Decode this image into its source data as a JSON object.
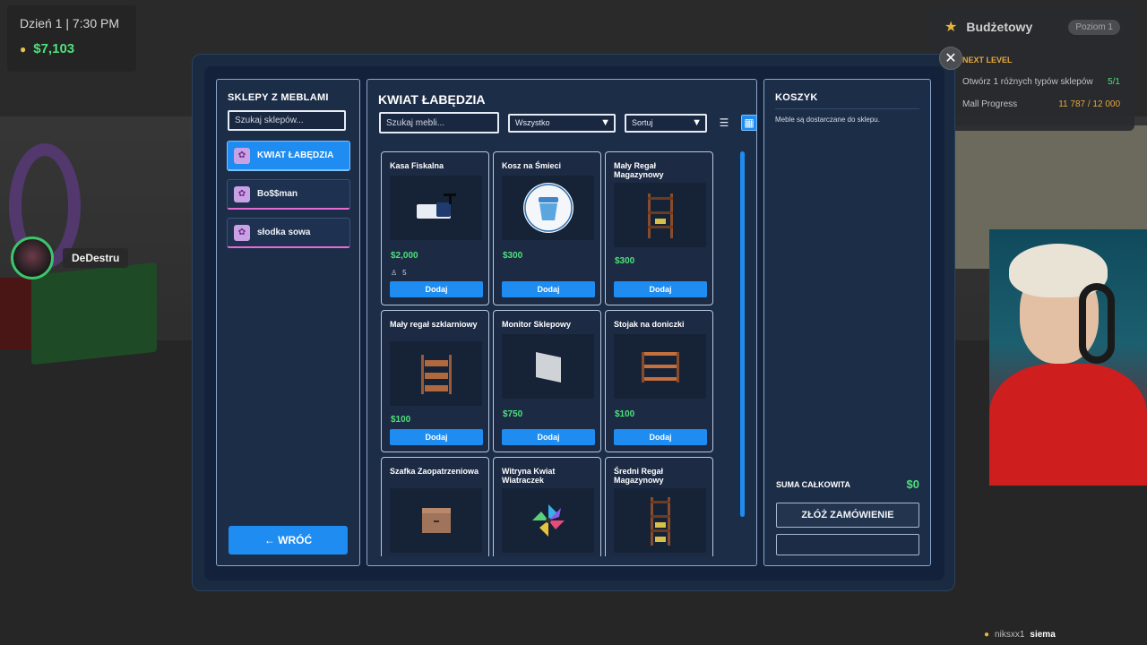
{
  "hud": {
    "day": "Dzień 1 | 7:30 PM",
    "money": "$7,103"
  },
  "player": {
    "name": "DeDestru"
  },
  "level_panel": {
    "title": "Budżetowy",
    "level": "Poziom 1",
    "next_level": "NEXT LEVEL",
    "goals": [
      {
        "label": "Otwórz 1 różnych typów sklepów",
        "value": "5/1"
      },
      {
        "label": "Mall Progress",
        "value": "11 787 / 12 000"
      }
    ]
  },
  "shops": {
    "title": "SKLEPY Z MEBLAMI",
    "search_placeholder": "Szukaj sklepów...",
    "items": [
      {
        "label": "KWIAT ŁABĘDZIA",
        "active": true
      },
      {
        "label": "Bo$$man",
        "active": false
      },
      {
        "label": "słodka sowa",
        "active": false
      }
    ],
    "back_label": "← WRÓĆ"
  },
  "catalog": {
    "title": "KWIAT ŁABĘDZIA",
    "search_placeholder": "Szukaj mebli...",
    "filter_value": "Wszystko",
    "sort_value": "Sortuj",
    "items": [
      {
        "name": "Kasa Fiskalna",
        "price": "$2,000",
        "stock": "5",
        "button": "Dodaj",
        "icon": "cash-register-icon"
      },
      {
        "name": "Kosz na Śmieci",
        "price": "$300",
        "button": "Dodaj",
        "icon": "trash-bin-icon"
      },
      {
        "name": "Mały Regał Magazynowy",
        "price": "$300",
        "button": "Dodaj",
        "icon": "storage-shelf-icon"
      },
      {
        "name": "Mały regał szklarniowy",
        "price": "$100",
        "button": "Dodaj",
        "icon": "greenhouse-shelf-icon"
      },
      {
        "name": "Monitor Sklepowy",
        "price": "$750",
        "button": "Dodaj",
        "icon": "monitor-icon"
      },
      {
        "name": "Stojak na doniczki",
        "price": "$100",
        "button": "Dodaj",
        "icon": "pot-stand-icon"
      },
      {
        "name": "Szafka Zaopatrzeniowa",
        "icon": "supply-cabinet-icon"
      },
      {
        "name": "Witryna Kwiat Wiatraczek",
        "icon": "pinwheel-icon"
      },
      {
        "name": "Średni Regał Magazynowy",
        "icon": "medium-shelf-icon"
      }
    ]
  },
  "cart": {
    "title": "KOSZYK",
    "note": "Meble są dostarczane do sklepu.",
    "sum_label": "SUMA CAŁKOWITA",
    "sum_value": "$0",
    "order_label": "ZŁÓŻ ZAMÓWIENIE"
  },
  "chat": {
    "user": "niksxx1",
    "message": "siema"
  },
  "colors": {
    "accent": "#1e8cf0",
    "price": "#4ee07a",
    "shop_underline": "#e76bd2"
  }
}
